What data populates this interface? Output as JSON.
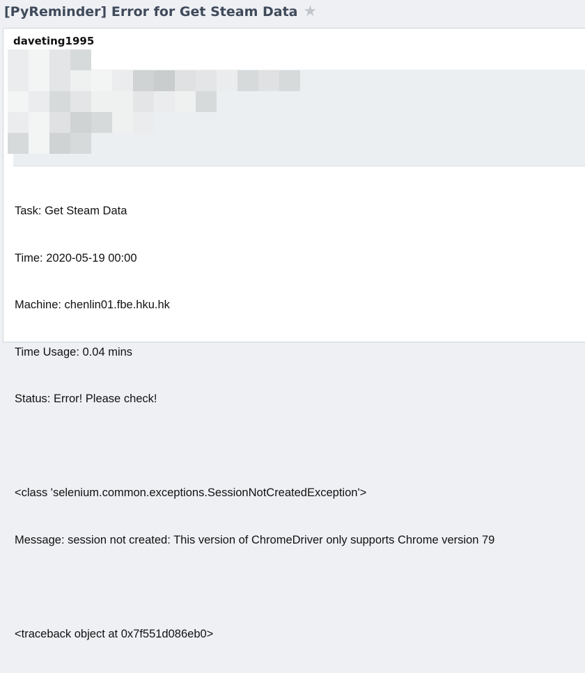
{
  "email": {
    "subject": "[PyReminder] Error for Get Steam Data",
    "star_icon": "star-icon",
    "sender": "daveting1995",
    "redaction_colors": [
      "#e3e5e6",
      "#d7dadb",
      "#cfd3d3",
      "#eaeced",
      "#f3f4f4",
      "#dfe1e2",
      "#c9cdce",
      "#eff1f1"
    ],
    "body": {
      "task": "Task: Get Steam Data",
      "time": "Time: 2020-05-19 00:00",
      "machine": "Machine: chenlin01.fbe.hku.hk",
      "time_usage": "Time Usage: 0.04 mins",
      "status": "Status: Error! Please check!",
      "exception_class": "<class 'selenium.common.exceptions.SessionNotCreatedException'>",
      "message": "Message: session not created: This version of ChromeDriver only supports Chrome version 79",
      "traceback": "<traceback object at 0x7f551d086eb0>"
    }
  }
}
